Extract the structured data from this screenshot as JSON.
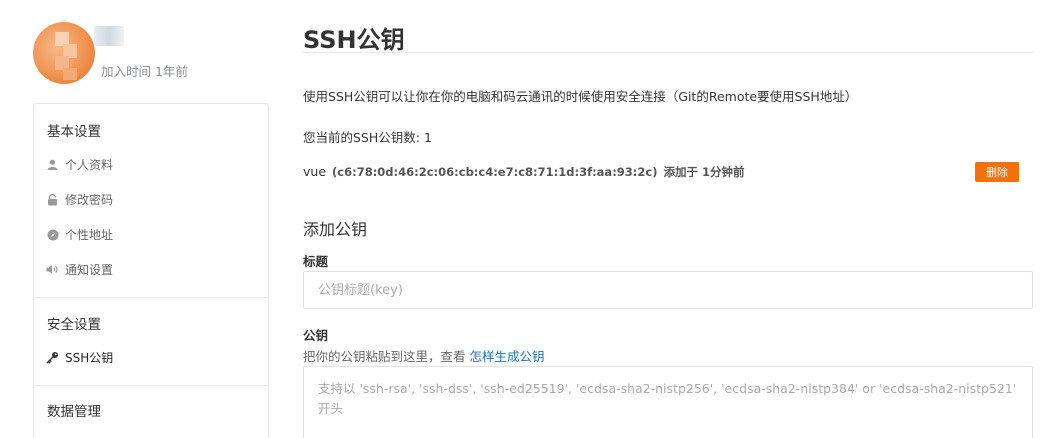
{
  "profile": {
    "joined": "加入时间 1年前"
  },
  "sidebar": {
    "sections": [
      {
        "title": "基本设置",
        "items": [
          {
            "label": "个人资料",
            "icon": "user-icon"
          },
          {
            "label": "修改密码",
            "icon": "lock-icon"
          },
          {
            "label": "个性地址",
            "icon": "compass-icon"
          },
          {
            "label": "通知设置",
            "icon": "volume-icon"
          }
        ]
      },
      {
        "title": "安全设置",
        "items": [
          {
            "label": "SSH公钥",
            "icon": "key-icon",
            "active": true
          }
        ]
      },
      {
        "title": "数据管理",
        "items": []
      }
    ]
  },
  "main": {
    "title": "SSH公钥",
    "description": "使用SSH公钥可以让你在你的电脑和码云通讯的时候使用安全连接（Git的Remote要使用SSH地址）",
    "count_text": "您当前的SSH公钥数: 1",
    "key": {
      "name": "vue",
      "fingerprint": "(c6:78:0d:46:2c:06:cb:c4:e7:c8:71:1d:3f:aa:93:2c)",
      "added": "添加于 1分钟前",
      "delete_label": "删除"
    },
    "add": {
      "heading": "添加公钥",
      "title_label": "标题",
      "title_placeholder": "公钥标题(key)",
      "key_label": "公钥",
      "hint_prefix": "把你的公钥粘贴到这里，查看",
      "hint_link": "怎样生成公钥",
      "key_placeholder": "支持以 'ssh-rsa', 'ssh-dss', 'ssh-ed25519', 'ecdsa-sha2-nistp256', 'ecdsa-sha2-nistp384' or 'ecdsa-sha2-nistp521' 开头"
    }
  },
  "colors": {
    "accent": "#f4700a",
    "link": "#1f6fb5"
  }
}
